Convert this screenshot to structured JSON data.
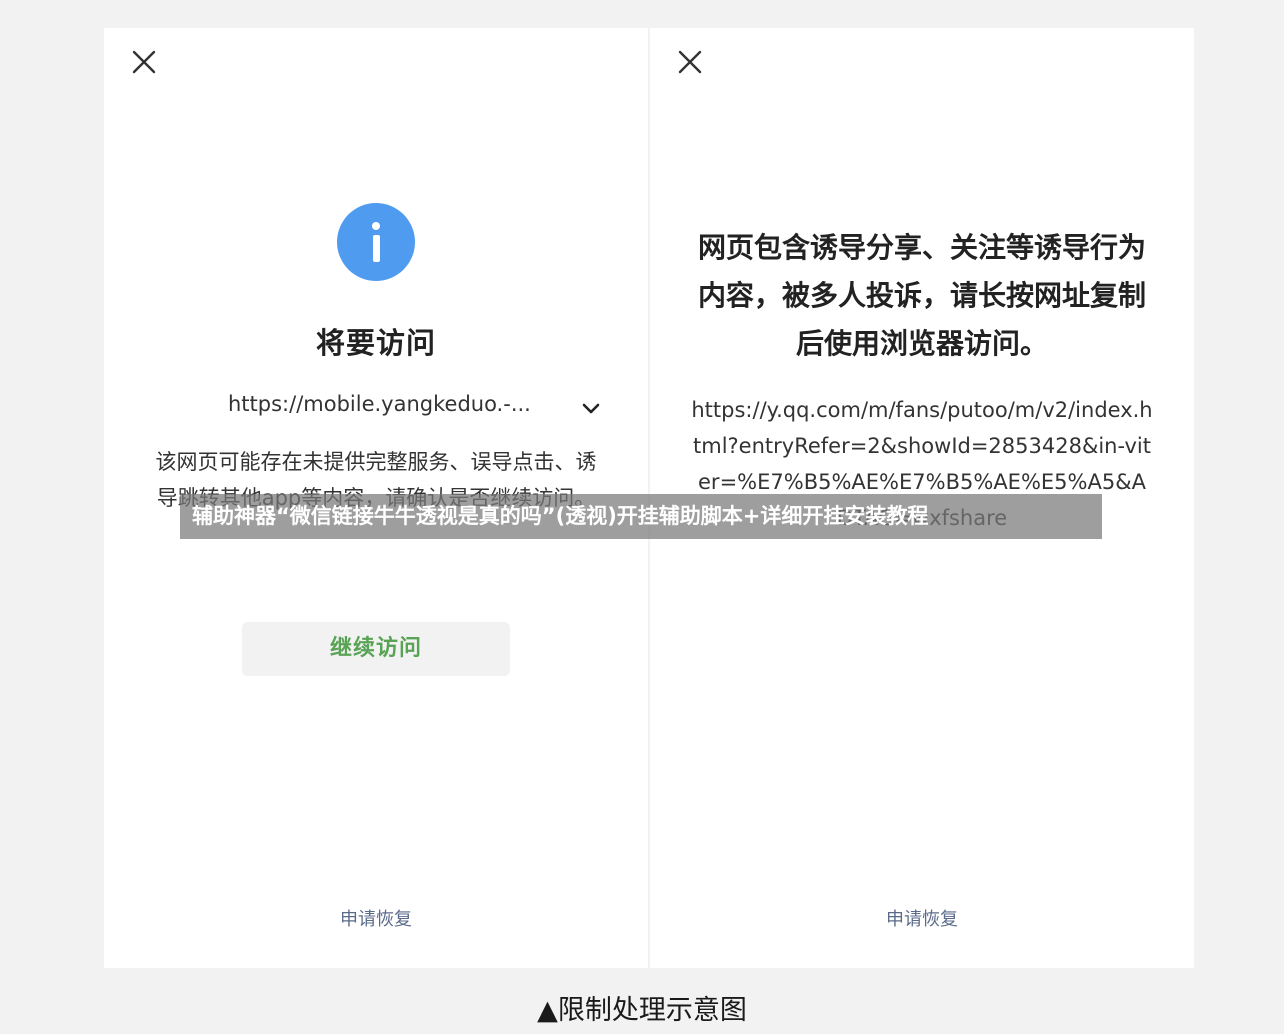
{
  "left_dialog": {
    "close_icon": "close-icon",
    "info_icon": "info-icon",
    "title": "将要访问",
    "url": "https://mobile.yangkeduo.-...",
    "expand_icon": "chevron-down-icon",
    "description": "该网页可能存在未提供完整服务、误导点击、诱导跳转其他app等内容，请确认是否继续访问。",
    "continue_label": "继续访问",
    "appeal_label": "申请恢复",
    "accent_color": "#59a356",
    "info_color": "#4e9bef"
  },
  "right_dialog": {
    "close_icon": "close-icon",
    "warning": "网页包含诱导分享、关注等诱导行为内容，被多人投诉，请长按网址复制后使用浏览器访问。",
    "url": "https://y.qq.com/m/fans/putoo/m/v2/index.html?entryRefer=2&showId=2853428&in-viter=%E7%B5%AE%E7%B5%AE%E5%A5&ADTAG=wxfshare",
    "appeal_label": "申请恢复"
  },
  "overlay_banner": {
    "text": "辅助神器“微信链接牛牛透视是真的吗”(透视)开挂辅助脚本+详细开挂安装教程"
  },
  "caption": "▲限制处理示意图"
}
